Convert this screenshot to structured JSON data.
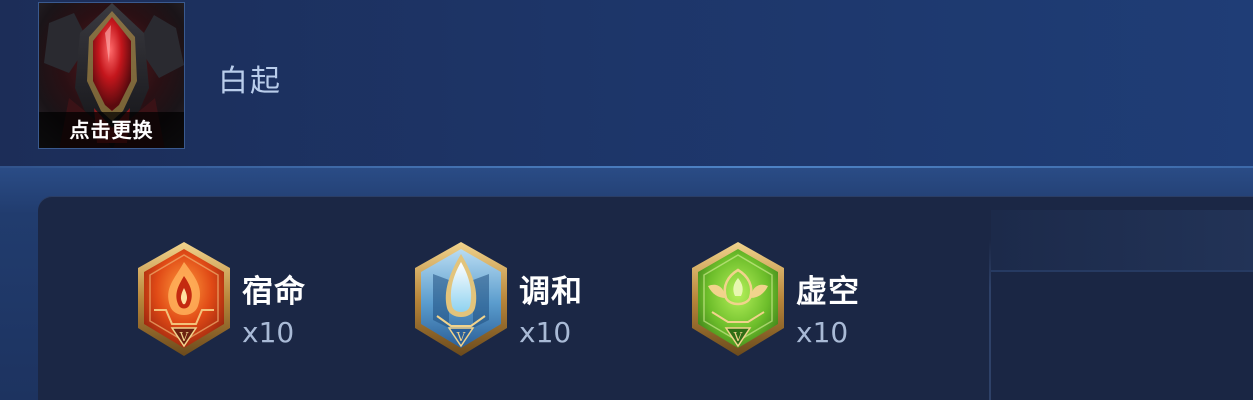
{
  "header": {
    "avatar_caption": "点击更换",
    "hero_name": "白起"
  },
  "runes": [
    {
      "name": "宿命",
      "count": "x10",
      "color": "red",
      "accent": "#d2451e",
      "icon": "flame-emblem-icon"
    },
    {
      "name": "调和",
      "count": "x10",
      "color": "blue",
      "accent": "#4a8fc9",
      "icon": "droplet-emblem-icon"
    },
    {
      "name": "虚空",
      "count": "x10",
      "color": "green",
      "accent": "#6bbd2c",
      "icon": "leaf-emblem-icon"
    }
  ],
  "colors": {
    "background": "#1d3360",
    "panel": "#1b2745",
    "hero_name_text": "#b9cdeb",
    "count_text": "#a9bad6",
    "gold_frame": "#c9a35a"
  }
}
